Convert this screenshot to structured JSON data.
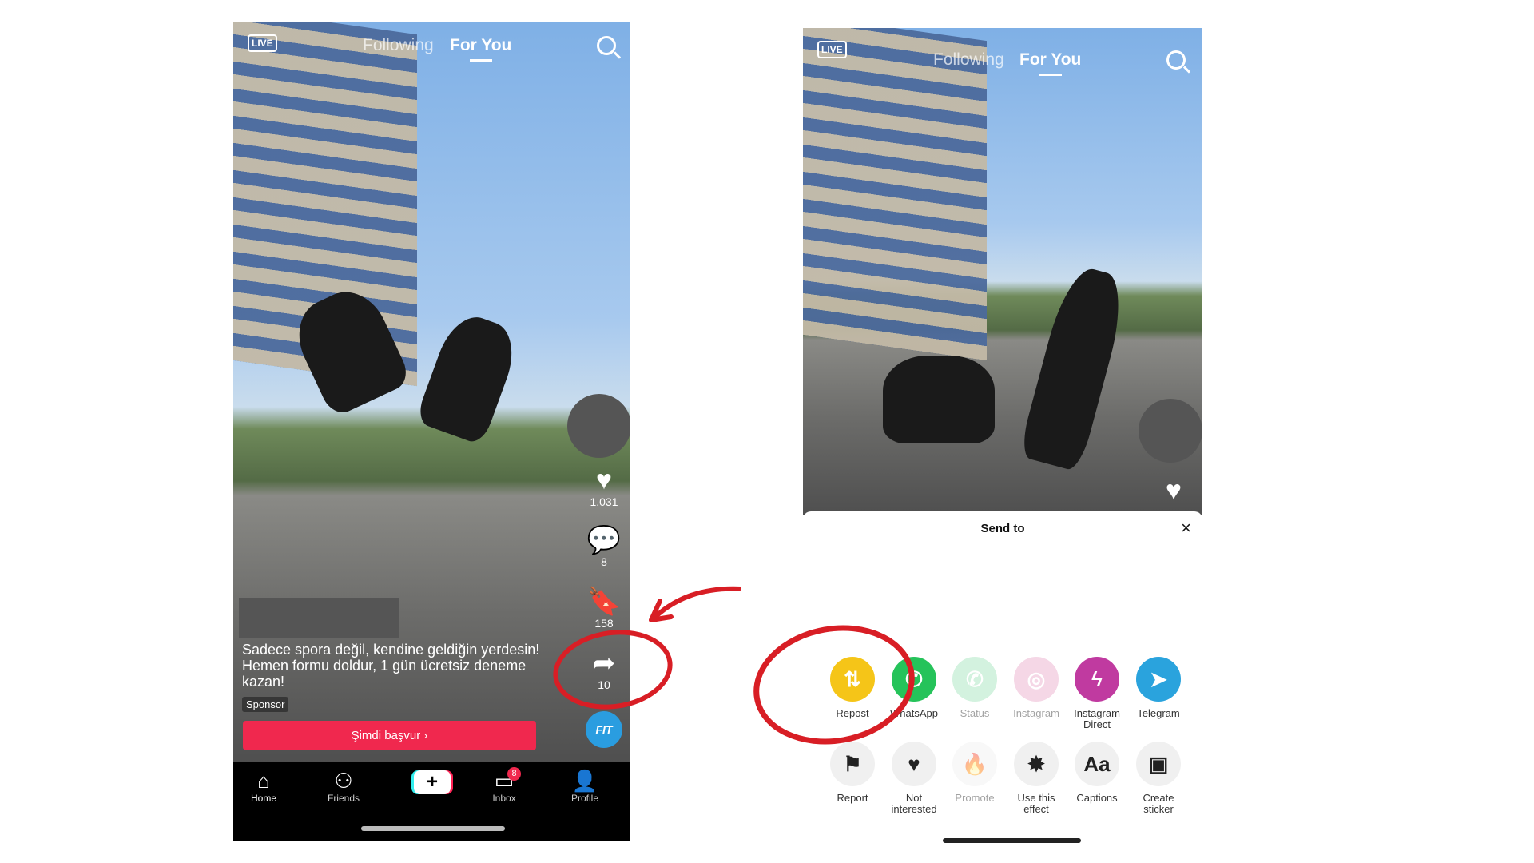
{
  "left_phone": {
    "header": {
      "live_label": "LIVE",
      "tabs": [
        "Following",
        "For You"
      ],
      "active_tab": "For You",
      "search_icon": "search-icon"
    },
    "actions": {
      "likes": "1.031",
      "comments": "8",
      "saves": "158",
      "shares": "10",
      "brand_badge": "FIT"
    },
    "caption": "Sadece spora değil, kendine geldiğin yerdesin! Hemen formu doldur, 1 gün ücretsiz deneme kazan!",
    "sponsor_label": "Sponsor",
    "cta_button": "Şimdi başvur ›",
    "nav": [
      {
        "label": "Home",
        "icon": "home-icon"
      },
      {
        "label": "Friends",
        "icon": "friends-icon"
      },
      {
        "label": "",
        "icon": "create-icon"
      },
      {
        "label": "Inbox",
        "icon": "inbox-icon",
        "badge": "8"
      },
      {
        "label": "Profile",
        "icon": "profile-icon"
      }
    ]
  },
  "right_phone": {
    "header": {
      "live_label": "LIVE",
      "tabs": [
        "Following",
        "For You"
      ],
      "active_tab": "For You"
    },
    "sheet": {
      "title": "Send to",
      "share_row": [
        {
          "label": "Repost",
          "color": "#f5c518",
          "icon": "repost-icon"
        },
        {
          "label": "WhatsApp",
          "color": "#25c35a",
          "icon": "whatsapp-icon"
        },
        {
          "label": "Status",
          "color": "#9fe3b9",
          "icon": "whatsapp-status-icon"
        },
        {
          "label": "Instagram",
          "color": "#e9a7c8",
          "icon": "instagram-icon"
        },
        {
          "label": "Instagram Direct",
          "color": "#c03aa0",
          "icon": "messenger-icon"
        },
        {
          "label": "Telegram",
          "color": "#2aa3dd",
          "icon": "telegram-icon"
        }
      ],
      "action_row": [
        {
          "label": "Report",
          "icon": "flag-icon"
        },
        {
          "label": "Not interested",
          "icon": "broken-heart-icon"
        },
        {
          "label": "Promote",
          "icon": "flame-icon"
        },
        {
          "label": "Use this effect",
          "icon": "effect-icon"
        },
        {
          "label": "Captions",
          "icon": "captions-icon"
        },
        {
          "label": "Create sticker",
          "icon": "sticker-icon"
        }
      ]
    }
  },
  "annotation_color": "#d81e25"
}
